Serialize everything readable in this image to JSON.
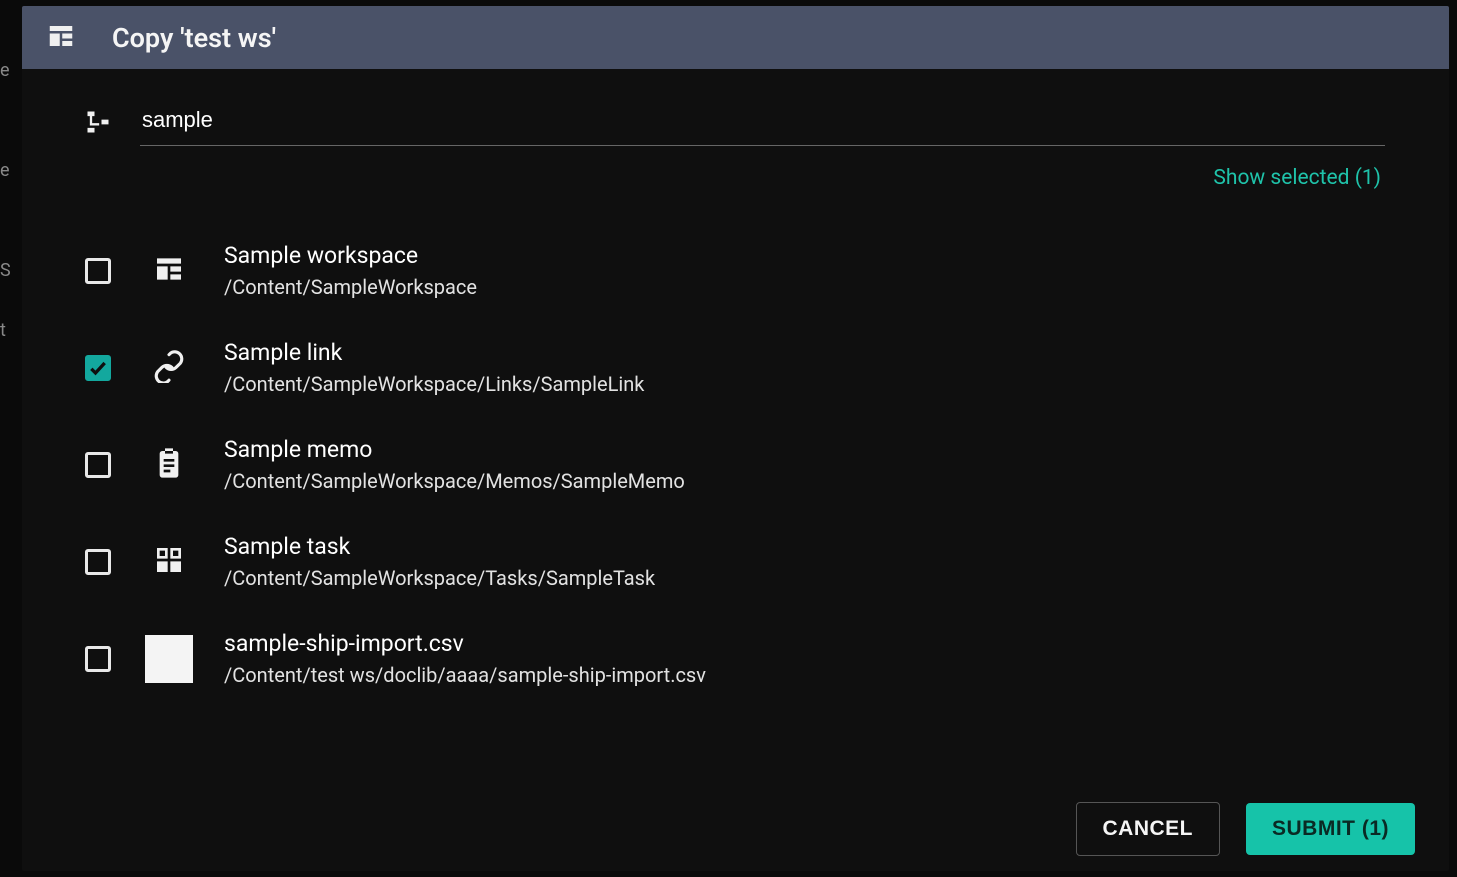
{
  "header": {
    "title": "Copy 'test ws'"
  },
  "search": {
    "value": "sample"
  },
  "show_selected_label": "Show selected (1)",
  "items": [
    {
      "icon": "workspace",
      "checked": false,
      "title": "Sample workspace",
      "path": "/Content/SampleWorkspace"
    },
    {
      "icon": "link",
      "checked": true,
      "title": "Sample link",
      "path": "/Content/SampleWorkspace/Links/SampleLink"
    },
    {
      "icon": "memo",
      "checked": false,
      "title": "Sample memo",
      "path": "/Content/SampleWorkspace/Memos/SampleMemo"
    },
    {
      "icon": "task",
      "checked": false,
      "title": "Sample task",
      "path": "/Content/SampleWorkspace/Tasks/SampleTask"
    },
    {
      "icon": "file",
      "checked": false,
      "title": "sample-ship-import.csv",
      "path": "/Content/test ws/doclib/aaaa/sample-ship-import.csv"
    }
  ],
  "footer": {
    "cancel": "CANCEL",
    "submit": "SUBMIT (1)"
  }
}
